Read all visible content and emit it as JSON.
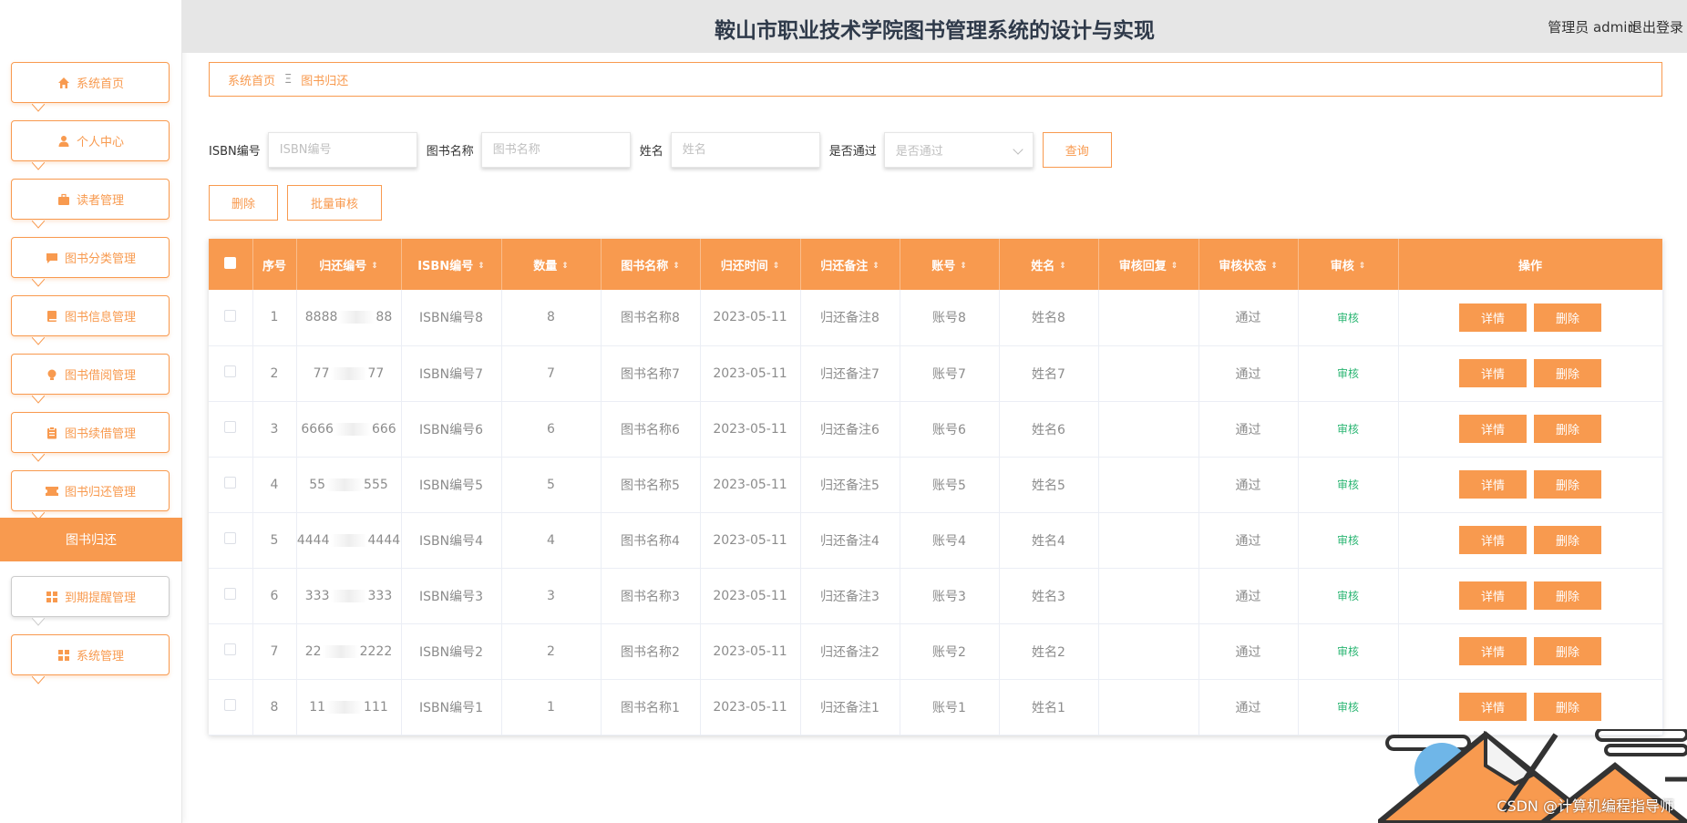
{
  "header": {
    "title": "鞍山市职业技术学院图书管理系统的设计与实现",
    "user": "管理员 admin",
    "logout": "退出登录"
  },
  "sidebar": {
    "items": [
      {
        "label": "系统首页",
        "icon": "home-icon"
      },
      {
        "label": "个人中心",
        "icon": "user-icon"
      },
      {
        "label": "读者管理",
        "icon": "briefcase-icon"
      },
      {
        "label": "图书分类管理",
        "icon": "chat-icon"
      },
      {
        "label": "图书信息管理",
        "icon": "book-icon"
      },
      {
        "label": "图书借阅管理",
        "icon": "bulb-icon"
      },
      {
        "label": "图书续借管理",
        "icon": "clipboard-icon"
      },
      {
        "label": "图书归还管理",
        "icon": "ticket-icon"
      },
      {
        "label": "到期提醒管理",
        "icon": "grid-icon"
      },
      {
        "label": "系统管理",
        "icon": "grid-icon"
      }
    ],
    "active_sub": "图书归还"
  },
  "breadcrumb": {
    "home": "系统首页",
    "current": "图书归还"
  },
  "search": {
    "isbn_label": "ISBN编号",
    "isbn_placeholder": "ISBN编号",
    "name_label": "图书名称",
    "name_placeholder": "图书名称",
    "person_label": "姓名",
    "person_placeholder": "姓名",
    "pass_label": "是否通过",
    "pass_placeholder": "是否通过",
    "query_button": "查询"
  },
  "actions": {
    "delete": "删除",
    "batch": "批量审核"
  },
  "table": {
    "headers": [
      "序号",
      "归还编号",
      "ISBN编号",
      "数量",
      "图书名称",
      "归还时间",
      "归还备注",
      "账号",
      "姓名",
      "审核回复",
      "审核状态",
      "审核",
      "操作"
    ],
    "detail_label": "详情",
    "delete_label": "删除",
    "rows": [
      {
        "idx": "1",
        "code_a": "8888",
        "code_b": "88",
        "isbn": "ISBN编号8",
        "qty": "8",
        "name": "图书名称8",
        "date": "2023-05-11",
        "note": "归还备注8",
        "acct": "账号8",
        "person": "姓名8",
        "reply": "",
        "status": "通过",
        "review": "审核"
      },
      {
        "idx": "2",
        "code_a": "77",
        "code_b": "77",
        "isbn": "ISBN编号7",
        "qty": "7",
        "name": "图书名称7",
        "date": "2023-05-11",
        "note": "归还备注7",
        "acct": "账号7",
        "person": "姓名7",
        "reply": "",
        "status": "通过",
        "review": "审核"
      },
      {
        "idx": "3",
        "code_a": "6666",
        "code_b": "666",
        "isbn": "ISBN编号6",
        "qty": "6",
        "name": "图书名称6",
        "date": "2023-05-11",
        "note": "归还备注6",
        "acct": "账号6",
        "person": "姓名6",
        "reply": "",
        "status": "通过",
        "review": "审核"
      },
      {
        "idx": "4",
        "code_a": "55",
        "code_b": "555",
        "isbn": "ISBN编号5",
        "qty": "5",
        "name": "图书名称5",
        "date": "2023-05-11",
        "note": "归还备注5",
        "acct": "账号5",
        "person": "姓名5",
        "reply": "",
        "status": "通过",
        "review": "审核"
      },
      {
        "idx": "5",
        "code_a": "4444",
        "code_b": "4444",
        "isbn": "ISBN编号4",
        "qty": "4",
        "name": "图书名称4",
        "date": "2023-05-11",
        "note": "归还备注4",
        "acct": "账号4",
        "person": "姓名4",
        "reply": "",
        "status": "通过",
        "review": "审核"
      },
      {
        "idx": "6",
        "code_a": "333",
        "code_b": "333",
        "isbn": "ISBN编号3",
        "qty": "3",
        "name": "图书名称3",
        "date": "2023-05-11",
        "note": "归还备注3",
        "acct": "账号3",
        "person": "姓名3",
        "reply": "",
        "status": "通过",
        "review": "审核"
      },
      {
        "idx": "7",
        "code_a": "22",
        "code_b": "2222",
        "isbn": "ISBN编号2",
        "qty": "2",
        "name": "图书名称2",
        "date": "2023-05-11",
        "note": "归还备注2",
        "acct": "账号2",
        "person": "姓名2",
        "reply": "",
        "status": "通过",
        "review": "审核"
      },
      {
        "idx": "8",
        "code_a": "11",
        "code_b": "111",
        "isbn": "ISBN编号1",
        "qty": "1",
        "name": "图书名称1",
        "date": "2023-05-11",
        "note": "归还备注1",
        "acct": "账号1",
        "person": "姓名1",
        "reply": "",
        "status": "通过",
        "review": "审核"
      }
    ]
  },
  "watermark": "CSDN @计算机编程指导师",
  "colors": {
    "accent": "#f89a4f",
    "review_green": "#2bb673",
    "header_bg": "#e6e6e6"
  }
}
